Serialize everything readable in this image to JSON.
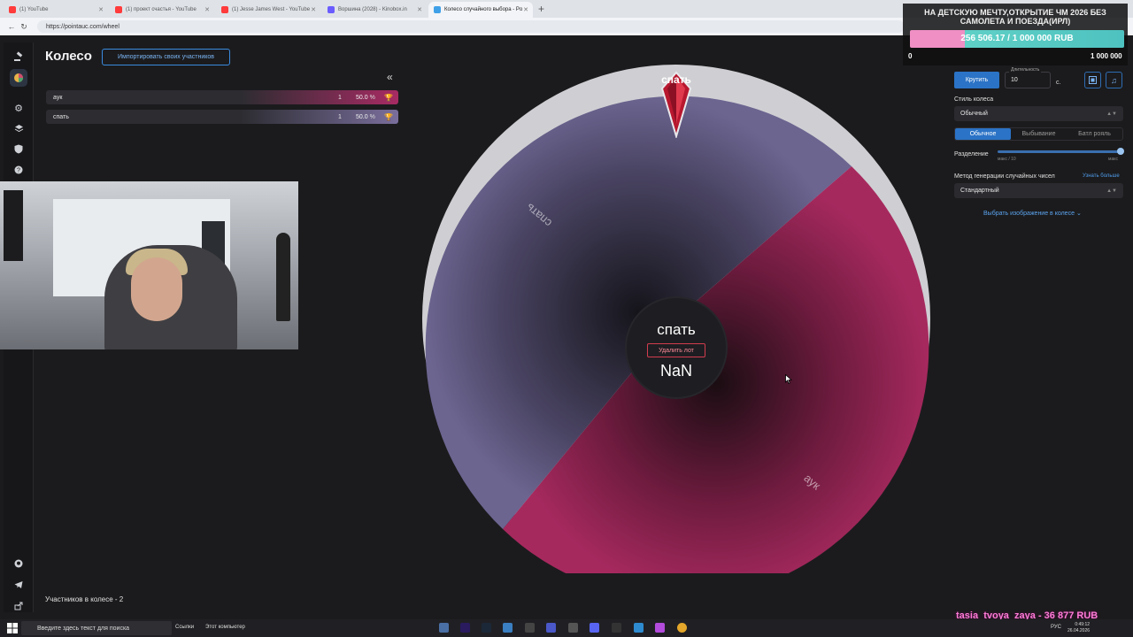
{
  "browser": {
    "tabs": [
      {
        "title": "(1) YouTube",
        "color": "#ff3b3b"
      },
      {
        "title": "(1) проект счастья - YouTube",
        "color": "#ff3b3b"
      },
      {
        "title": "(1) Jesse James West - YouTube",
        "color": "#ff3b3b"
      },
      {
        "title": "Воршина (2028) - Kinobox.in",
        "color": "#6a5cff"
      },
      {
        "title": "Колесо случайного выбора - Po",
        "color": "#3fa0e8"
      }
    ],
    "new_tab": "+",
    "url": "https://pointauc.com/wheel"
  },
  "sidebar": {
    "icons": [
      "gavel-icon",
      "wheel-icon",
      "gear-icon",
      "layers-icon",
      "shield-icon",
      "help-icon",
      "github-icon",
      "telegram-icon",
      "export-icon"
    ]
  },
  "header": {
    "title": "Колесо",
    "import_label": "Импортировать своих участников",
    "collapse": "«"
  },
  "lots": [
    {
      "name": "аук",
      "amount": "1",
      "percent": "50.0",
      "percent_sign": "%",
      "color": "#d0306e"
    },
    {
      "name": "спать",
      "amount": "1",
      "percent": "50.0",
      "percent_sign": "%",
      "color": "#8a7fb2"
    }
  ],
  "participants_label": "Участников в колесе - 2",
  "wheel": {
    "slices": [
      {
        "label": "спать",
        "color": "#6f6690",
        "share": 0.5
      },
      {
        "label": "аук",
        "color": "#a02a5d",
        "share": 0.5
      }
    ],
    "winner": "спать",
    "delete_label": "Удалить лот",
    "value": "NaN",
    "pointer_label": "спать"
  },
  "controls": {
    "spin_label": "Крутить",
    "duration_label": "Длительность",
    "duration_value": "10",
    "duration_unit": "с.",
    "style_label": "Стиль колеса",
    "style_value": "Обычный",
    "modes": [
      "Обычное",
      "Выбывание",
      "Батл рояль"
    ],
    "active_mode": "Обычное",
    "split_label": "Разделение",
    "split_min": "макс / 10",
    "split_max": "макс",
    "split_value": 1.0,
    "rng_label": "Метод генерации случайных чисел",
    "learn_more": "Узнать больше",
    "rng_value": "Стандартный",
    "choose_image": "Выбрать изображение в колесе"
  },
  "donation": {
    "title": "НА ДЕТСКУЮ МЕЧТУ,ОТКРЫТИЕ ЧМ 2026 БЕЗ САМОЛЕТА И ПОЕЗДА(ИРЛ)",
    "progress_text": "256 506.17 / 1 000 000 RUB",
    "progress": 0.2565,
    "min": "0",
    "max": "1 000 000"
  },
  "donor_line": "tasia_tvoya_zaya - 36 877 RUB",
  "taskbar": {
    "search_placeholder": "Введите здесь текст для поиска",
    "links_label": "Ссылки",
    "computer_label": "Этот компьютер",
    "lang": "РУС",
    "time": "0:49:12",
    "date": "26.04.2026"
  }
}
